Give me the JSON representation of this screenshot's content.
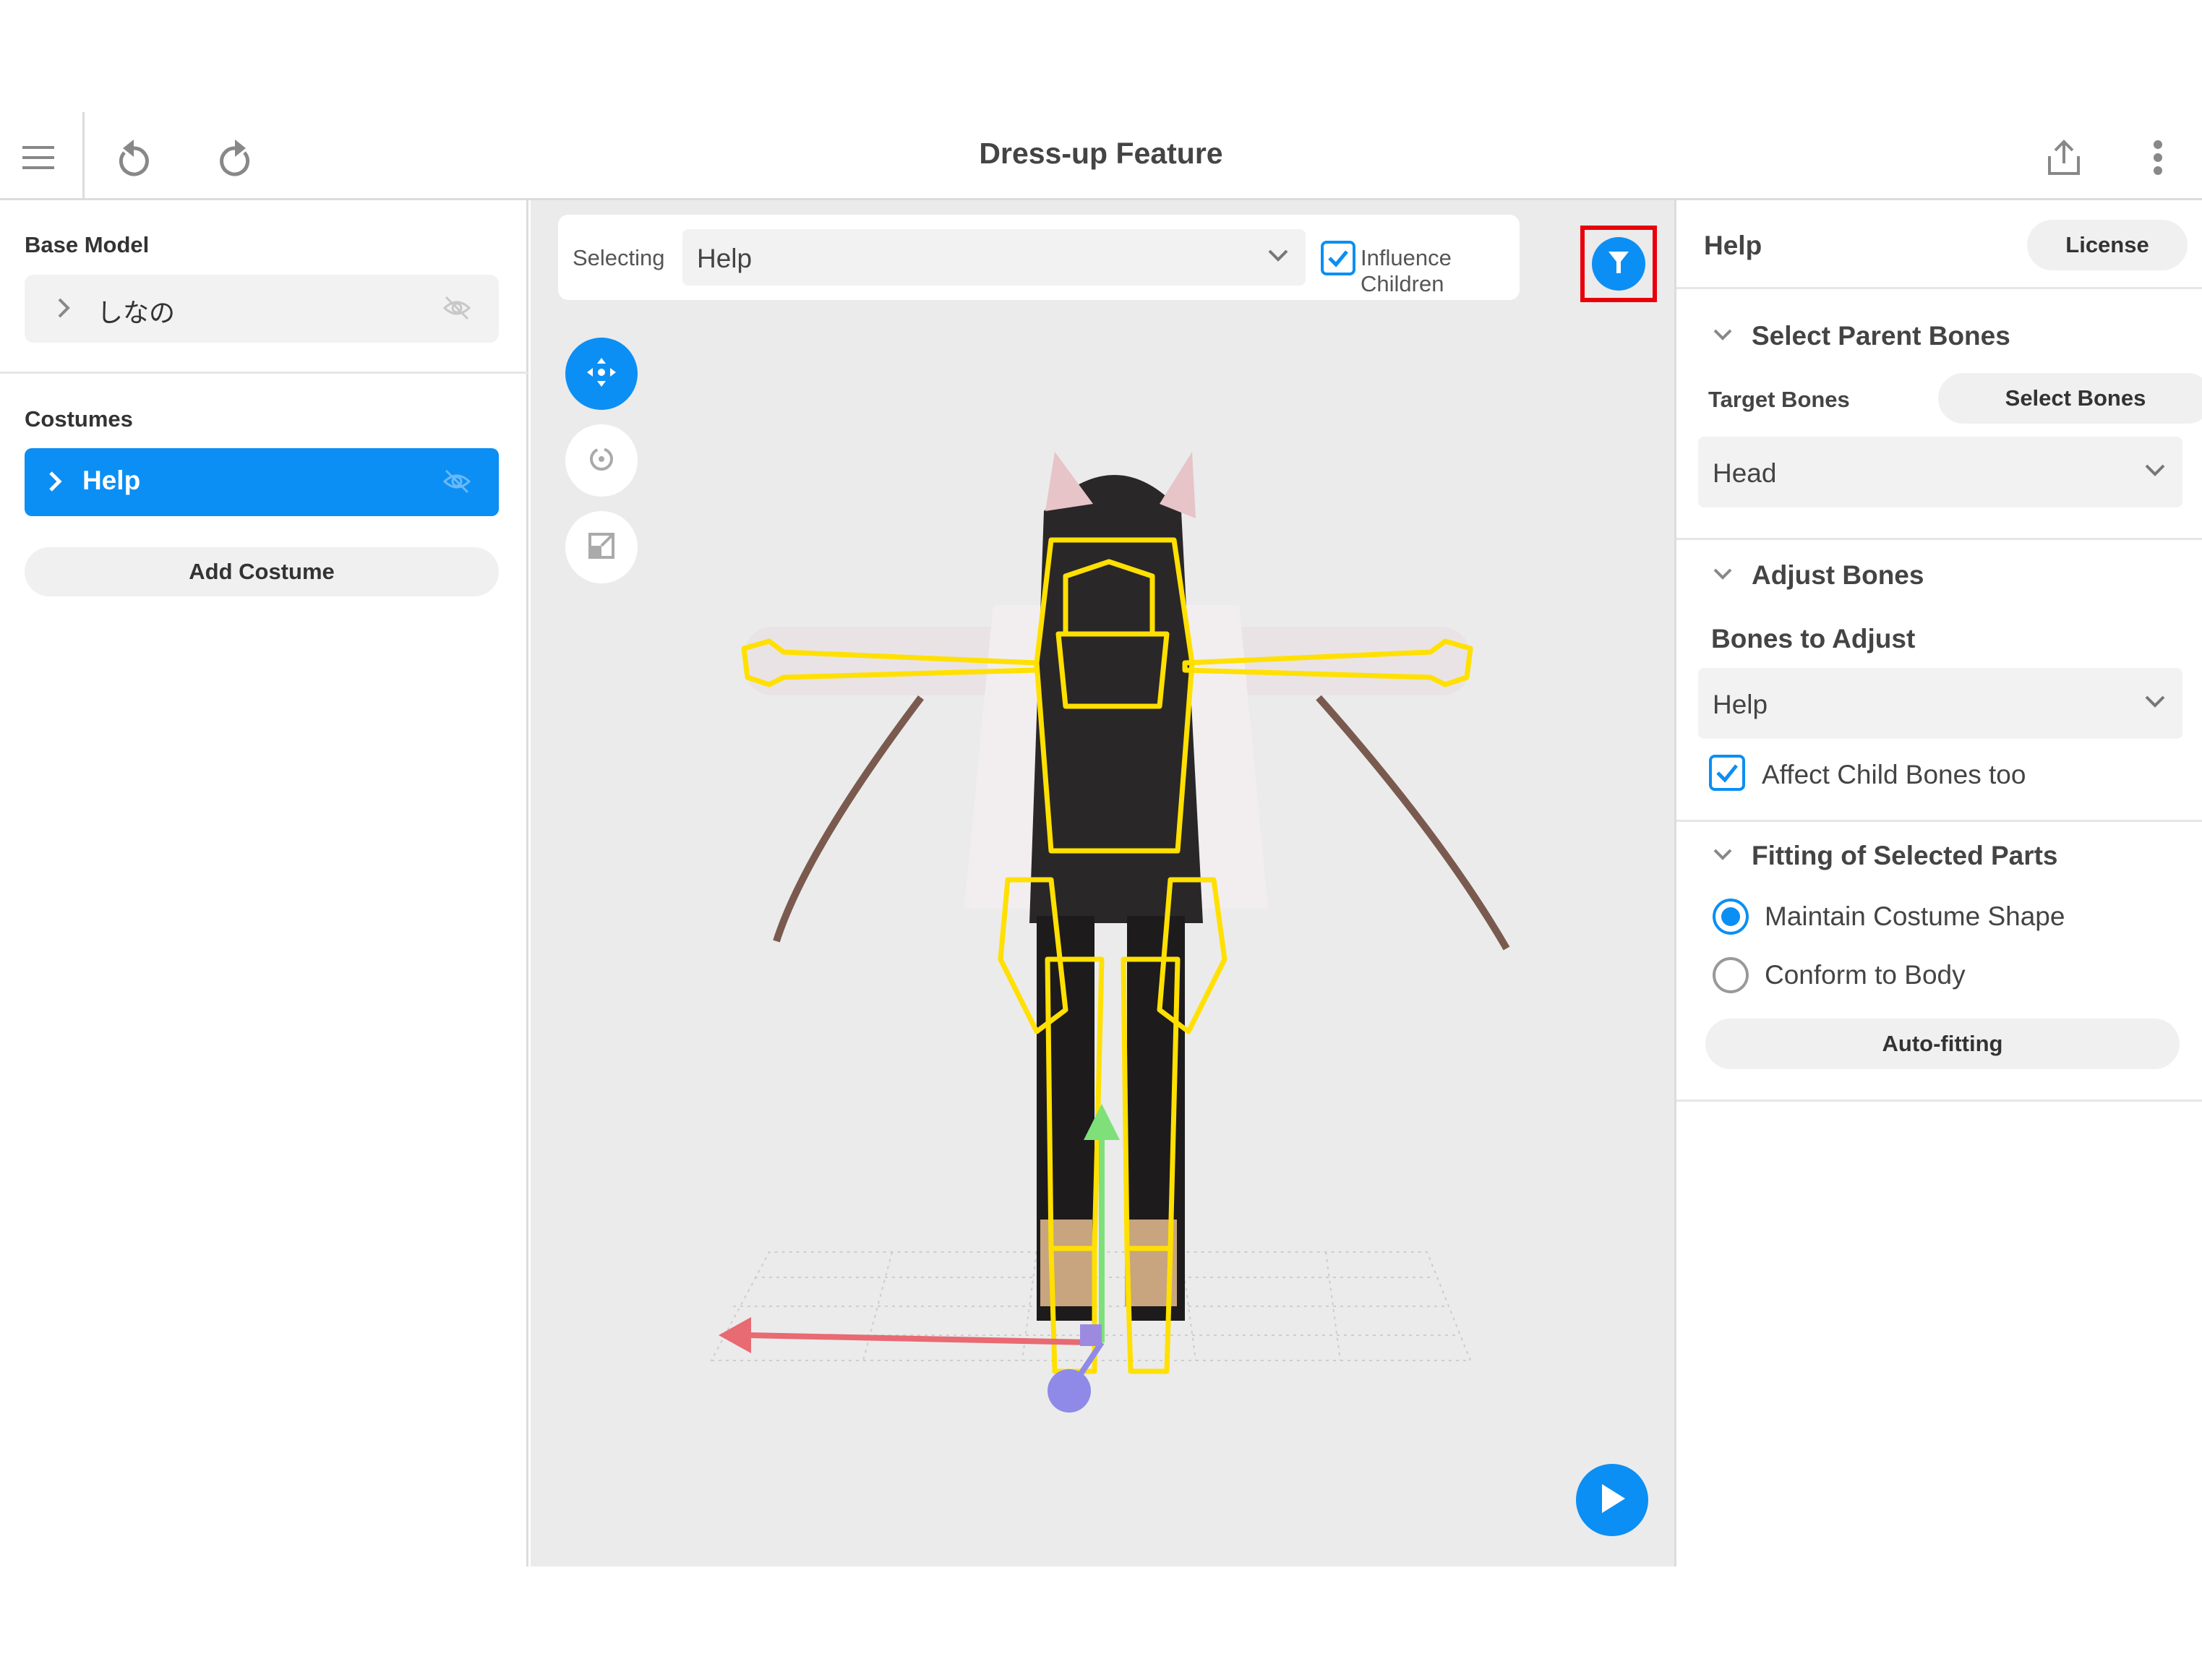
{
  "app": {
    "title": "Dress-up Feature"
  },
  "toolbar": {
    "menu_icon": "hamburger-icon",
    "undo_icon": "undo-icon",
    "redo_icon": "redo-icon",
    "share_icon": "share-icon",
    "more_icon": "more-vertical-icon"
  },
  "left_panel": {
    "base_model_label": "Base Model",
    "base_model_name": "しなの",
    "costumes_label": "Costumes",
    "costume_name": "Help",
    "add_costume_label": "Add Costume"
  },
  "viewport": {
    "selecting_label": "Selecting",
    "selecting_value": "Help",
    "influence_children_label": "Influence Children",
    "influence_children_checked": true,
    "filter_icon": "filter-icon",
    "tools": [
      "move-icon",
      "rotate-icon",
      "scale-icon"
    ],
    "play_icon": "play-icon"
  },
  "right_panel": {
    "title": "Help",
    "license_label": "License",
    "select_parent_bones": {
      "heading": "Select Parent Bones",
      "target_bones_label": "Target Bones",
      "select_bones_label": "Select Bones",
      "target_value": "Head"
    },
    "adjust_bones": {
      "heading": "Adjust Bones",
      "bones_to_adjust_label": "Bones to Adjust",
      "bones_value": "Help",
      "affect_child_label": "Affect Child Bones too",
      "affect_child_checked": true
    },
    "fitting": {
      "heading": "Fitting of Selected Parts",
      "options": [
        "Maintain Costume Shape",
        "Conform to Body"
      ],
      "selected": "Maintain Costume Shape",
      "auto_fitting_label": "Auto-fitting"
    }
  },
  "colors": {
    "accent": "#0b8ff4",
    "highlight_outline": "#e8000b",
    "bone_outline": "#ffe000"
  }
}
